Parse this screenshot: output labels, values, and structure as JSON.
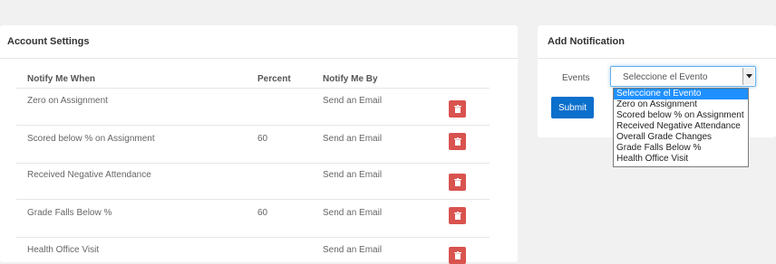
{
  "account_settings": {
    "title": "Account Settings",
    "columns": [
      "Notify Me When",
      "Percent",
      "Notify Me By"
    ],
    "rows": [
      {
        "event": "Zero on Assignment",
        "percent": "",
        "method": "Send an Email"
      },
      {
        "event": "Scored below % on Assignment",
        "percent": "60",
        "method": "Send an Email"
      },
      {
        "event": "Received Negative Attendance",
        "percent": "",
        "method": "Send an Email"
      },
      {
        "event": "Grade Falls Below %",
        "percent": "60",
        "method": "Send an Email"
      },
      {
        "event": "Health Office Visit",
        "percent": "",
        "method": "Send an Email"
      }
    ],
    "delete_icon": "trash-icon",
    "delete_color": "#d9534f"
  },
  "add_notification": {
    "title": "Add Notification",
    "events_label": "Events",
    "selected_event": "Seleccione el Evento",
    "submit_label": "Submit",
    "submit_color": "#0b6fcc",
    "options": [
      "Seleccione el Evento",
      "Zero on Assignment",
      "Scored below % on Assignment",
      "Received Negative Attendance",
      "Overall Grade Changes",
      "Grade Falls Below %",
      "Health Office Visit"
    ],
    "highlighted_option": 0,
    "highlight_color": "#1e90ff"
  }
}
